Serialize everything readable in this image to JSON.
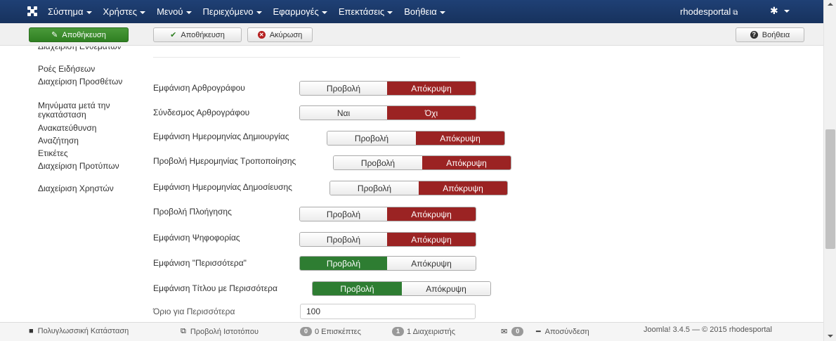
{
  "navbar": {
    "menu": [
      {
        "label": "Σύστημα"
      },
      {
        "label": "Χρήστες"
      },
      {
        "label": "Μενού"
      },
      {
        "label": "Περιεχόμενο"
      },
      {
        "label": "Εφαρμογές"
      },
      {
        "label": "Επεκτάσεις"
      },
      {
        "label": "Βοήθεια"
      }
    ],
    "site_label": "rhodesportal",
    "settings_icon": "gear-icon"
  },
  "toolbar": {
    "save_primary": "Αποθήκευση",
    "save": "Αποθήκευση",
    "cancel": "Ακύρωση",
    "help": "Βοήθεια"
  },
  "sidebar": {
    "items": [
      {
        "label": "Διαχείριση Ενθεμάτων"
      },
      {
        "label": "Ροές Ειδήσεων"
      },
      {
        "label": "Διαχείριση Προσθέτων"
      },
      {
        "label": "Μηνύματα μετά την εγκατάσταση"
      },
      {
        "label": "Ανακατεύθυνση"
      },
      {
        "label": "Αναζήτηση"
      },
      {
        "label": "Ετικέτες"
      },
      {
        "label": "Διαχείριση Προτύπων"
      },
      {
        "label": "Διαχείριση Χρηστών"
      }
    ]
  },
  "form": {
    "rows": [
      {
        "label": "Εμφάνιση Αρθρογράφου",
        "options": [
          "Προβολή",
          "Απόκρυψη"
        ],
        "selected": 1
      },
      {
        "label": "Σύνδεσμος Αρθρογράφου",
        "options": [
          "Ναι",
          "Όχι"
        ],
        "selected": 1
      },
      {
        "label": "Εμφάνιση Ημερομηνίας Δημιουργίας",
        "options": [
          "Προβολή",
          "Απόκρυψη"
        ],
        "selected": 1
      },
      {
        "label": "Προβολή Ημερομηνίας Τροποποίησης",
        "options": [
          "Προβολή",
          "Απόκρυψη"
        ],
        "selected": 1
      },
      {
        "label": "Εμφάνιση Ημερομηνίας Δημοσίευσης",
        "options": [
          "Προβολή",
          "Απόκρυψη"
        ],
        "selected": 1
      },
      {
        "label": "Προβολή Πλοήγησης",
        "options": [
          "Προβολή",
          "Απόκρυψη"
        ],
        "selected": 1
      },
      {
        "label": "Εμφάνιση Ψηφοφορίας",
        "options": [
          "Προβολή",
          "Απόκρυψη"
        ],
        "selected": 1
      },
      {
        "label": "Εμφάνιση \"Περισσότερα\"",
        "options": [
          "Προβολή",
          "Απόκρυψη"
        ],
        "selected": 0
      },
      {
        "label": "Εμφάνιση Τίτλου με Περισσότερα",
        "options": [
          "Προβολή",
          "Απόκρυψη"
        ],
        "selected": 0
      }
    ],
    "readmore_limit_label": "Όριο για Περισσότερα",
    "readmore_limit_value": "100"
  },
  "statusbar": {
    "multilang": "Πολυγλωσσική Κατάσταση",
    "view_site": "Προβολή Ιστοτόπου",
    "visitors_count": "0",
    "visitors_label": "0 Επισκέπτες",
    "admins_count": "1",
    "admins_label": "1 Διαχειριστής",
    "messages_count": "0",
    "logout": "Αποσύνδεση",
    "version": "Joomla! 3.4.5 — © 2015 rhodesportal"
  },
  "colors": {
    "navbar": "#1b3a6b",
    "selected_red": "#9b2323",
    "selected_green": "#2e7d32",
    "primary_button": "#2f7f22"
  }
}
